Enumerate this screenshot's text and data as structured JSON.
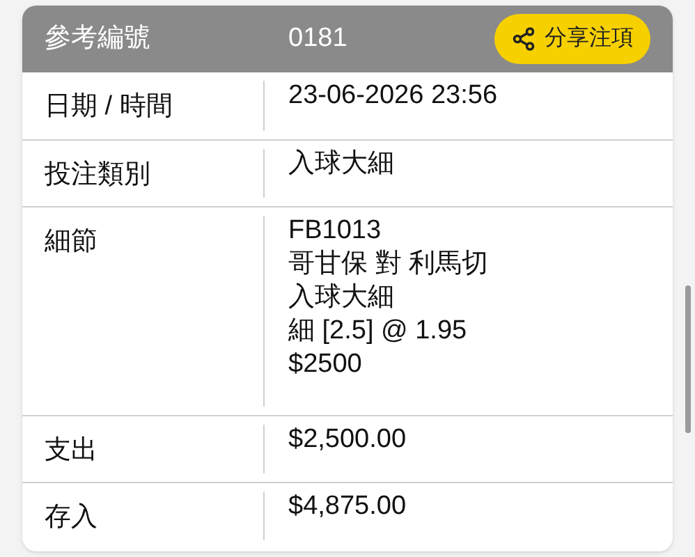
{
  "header": {
    "label": "參考編號",
    "value": "0181",
    "share_button": "分享注項"
  },
  "rows": [
    {
      "label": "日期 / 時間",
      "lines": [
        "23-06-2026 23:56"
      ]
    },
    {
      "label": "投注類別",
      "lines": [
        "入球大細"
      ]
    },
    {
      "label": "細節",
      "lines": [
        "FB1013",
        "哥甘保 對 利馬切",
        "入球大細",
        "細 [2.5] @ 1.95",
        "$2500"
      ]
    },
    {
      "label": "支出",
      "lines": [
        "$2,500.00"
      ]
    },
    {
      "label": "存入",
      "lines": [
        "$4,875.00"
      ]
    }
  ]
}
